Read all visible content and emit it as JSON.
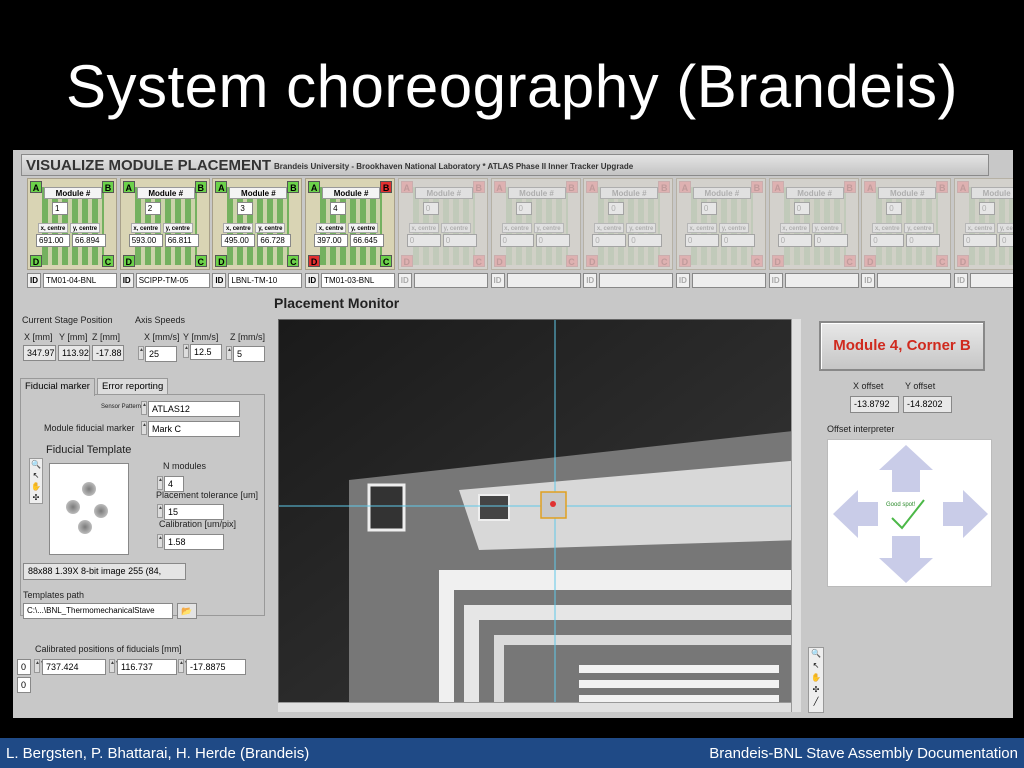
{
  "slide_title": "System choreography (Brandeis)",
  "header": {
    "title": "VISUALIZE MODULE PLACEMENT",
    "subtitle": "Brandeis University - Brookhaven National Laboratory * ATLAS Phase II Inner Tracker Upgrade"
  },
  "module_labels": {
    "module_num": "Module #",
    "x_centre": "x, centre",
    "y_centre": "y, centre",
    "id": "ID"
  },
  "modules": [
    {
      "num": "1",
      "x": "691.00",
      "y": "66.894",
      "id": "TM01-04-BNL",
      "active": true,
      "corner_b": "green",
      "corner_d": "green"
    },
    {
      "num": "2",
      "x": "593.00",
      "y": "66.811",
      "id": "SCIPP-TM-05",
      "active": true,
      "corner_b": "green",
      "corner_d": "green"
    },
    {
      "num": "3",
      "x": "495.00",
      "y": "66.728",
      "id": "LBNL-TM-10",
      "active": true,
      "corner_b": "green",
      "corner_d": "green"
    },
    {
      "num": "4",
      "x": "397.00",
      "y": "66.645",
      "id": "TM01-03-BNL",
      "active": true,
      "corner_b": "red",
      "corner_d": "red"
    },
    {
      "num": "0",
      "x": "0",
      "y": "0",
      "id": "",
      "active": false
    },
    {
      "num": "0",
      "x": "0",
      "y": "0",
      "id": "",
      "active": false
    },
    {
      "num": "0",
      "x": "0",
      "y": "0",
      "id": "",
      "active": false
    },
    {
      "num": "0",
      "x": "0",
      "y": "0",
      "id": "",
      "active": false
    },
    {
      "num": "0",
      "x": "0",
      "y": "0",
      "id": "",
      "active": false
    },
    {
      "num": "0",
      "x": "0",
      "y": "0",
      "id": "",
      "active": false
    },
    {
      "num": "0",
      "x": "0",
      "y": "0",
      "id": "",
      "active": false
    }
  ],
  "stage": {
    "label": "Current Stage Position",
    "x_label": "X [mm]",
    "y_label": "Y [mm]",
    "z_label": "Z [mm]",
    "x": "347.97",
    "y": "113.92",
    "z": "-17.88"
  },
  "speeds": {
    "label": "Axis Speeds",
    "x_label": "X [mm/s]",
    "y_label": "Y [mm/s]",
    "z_label": "Z [mm/s]",
    "x": "25",
    "y": "12.5",
    "z": "5"
  },
  "tabs": [
    "Fiducial marker",
    "Error reporting"
  ],
  "fiducial": {
    "sensor_pattern_label": "Sensor Pattern",
    "sensor_pattern": "ATLAS12",
    "module_marker_label": "Module fiducial marker",
    "module_marker": "Mark C",
    "template_label": "Fiducial Template",
    "n_modules_label": "N modules",
    "n_modules": "4",
    "tolerance_label": "Placement tolerance [um]",
    "tolerance": "15",
    "calibration_label": "Calibration [um/pix]",
    "calibration": "1.58",
    "image_info": "88x88 1.39X 8-bit image 255    (84,",
    "templates_path_label": "Templates path",
    "templates_path": "C:\\...\\BNL_ThermomechanicalStave"
  },
  "calibrated": {
    "label": "Calibrated positions of fiducials [mm]",
    "index": "0",
    "index2": "0",
    "x": "737.424",
    "y": "116.737",
    "z": "-17.8875"
  },
  "monitor": {
    "title": "Placement Monitor"
  },
  "corner_button": "Module 4,  Corner B",
  "offsets": {
    "x_label": "X offset",
    "y_label": "Y offset",
    "x": "-13.8792",
    "y": "-14.8202"
  },
  "interpreter": {
    "label": "Offset interpreter",
    "status": "Good spot!"
  },
  "footer": {
    "left": "L. Bergsten, P. Bhattarai, H. Herde (Brandeis)",
    "right": "Brandeis-BNL Stave Assembly Documentation"
  },
  "colors": {
    "footer_bar": "#1f4a86",
    "corner_ok": "#6cd24a",
    "corner_bad": "#e23030",
    "button_text": "#d02a1e",
    "crosshair": "#5fc8e8"
  }
}
